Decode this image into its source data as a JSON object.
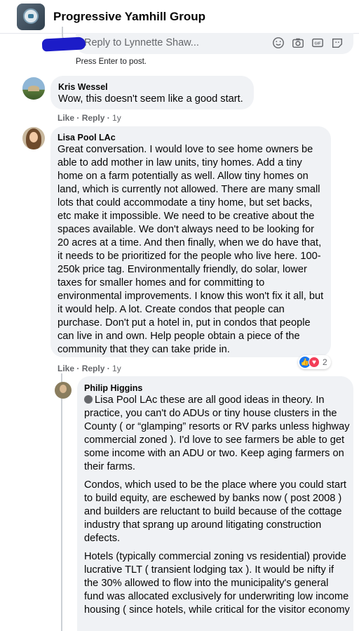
{
  "header": {
    "group_name": "Progressive Yamhill Group"
  },
  "reply_box": {
    "placeholder": "Reply to Lynnette Shaw...",
    "hint": "Press Enter to post.",
    "icons": [
      "smiley-icon",
      "camera-icon",
      "gif-icon",
      "sticker-icon"
    ]
  },
  "comments": [
    {
      "author": "Kris Wessel",
      "text": "Wow, this doesn't seem like a good start.",
      "like_label": "Like",
      "reply_label": "Reply",
      "time": "1y"
    },
    {
      "author": "Lisa Pool LAc",
      "text": "Great conversation. I would love to see home owners be able to add mother in law units, tiny homes. Add a tiny home on a farm potentially as well. Allow tiny homes on land, which is currently not allowed. There are many small lots that could accommodate a tiny home, but set backs, etc make it impossible. We need to be creative about the spaces available. We don't always need to be looking for 20 acres at a time. And then finally, when we do have that, it needs to be prioritized for the people who live here. 100-250k price tag. Environmentally friendly, do solar, lower taxes for smaller homes and for committing to environmental improvements. I know this won't fix it all, but it would help. A lot. Create condos that people can purchase. Don't put a hotel in, put in condos that people can live in and own. Help people obtain a piece of the community that they can take pride in.",
      "like_label": "Like",
      "reply_label": "Reply",
      "time": "1y",
      "reaction_count": "2"
    }
  ],
  "reply": {
    "author": "Philip Higgins",
    "mention": "Lisa Pool LAc",
    "para1_rest": " these are all good ideas in theory. In practice, you can't do ADUs or tiny house clusters in the County ( or “glamping” resorts or RV parks unless highway commercial zoned ). I'd love to see farmers be able to get some income with an ADU or two. Keep aging farmers on their farms.",
    "para2": "Condos, which used to be the place where you could start to build equity, are eschewed by banks now ( post 2008 ) and builders are reluctant to build because of the cottage industry that sprang up around litigating construction defects.",
    "para3": "Hotels (typically commercial zoning vs residential) provide lucrative TLT ( transient lodging tax ). It would be nifty if the 30% allowed to flow into the municipality's general fund was allocated exclusively for underwriting low income housing ( since hotels, while critical for the visitor economy"
  },
  "colors": {
    "bubble": "#f0f2f5",
    "secondary_text": "#65676b",
    "like_blue": "#1877f2",
    "love_red": "#f33e58"
  }
}
